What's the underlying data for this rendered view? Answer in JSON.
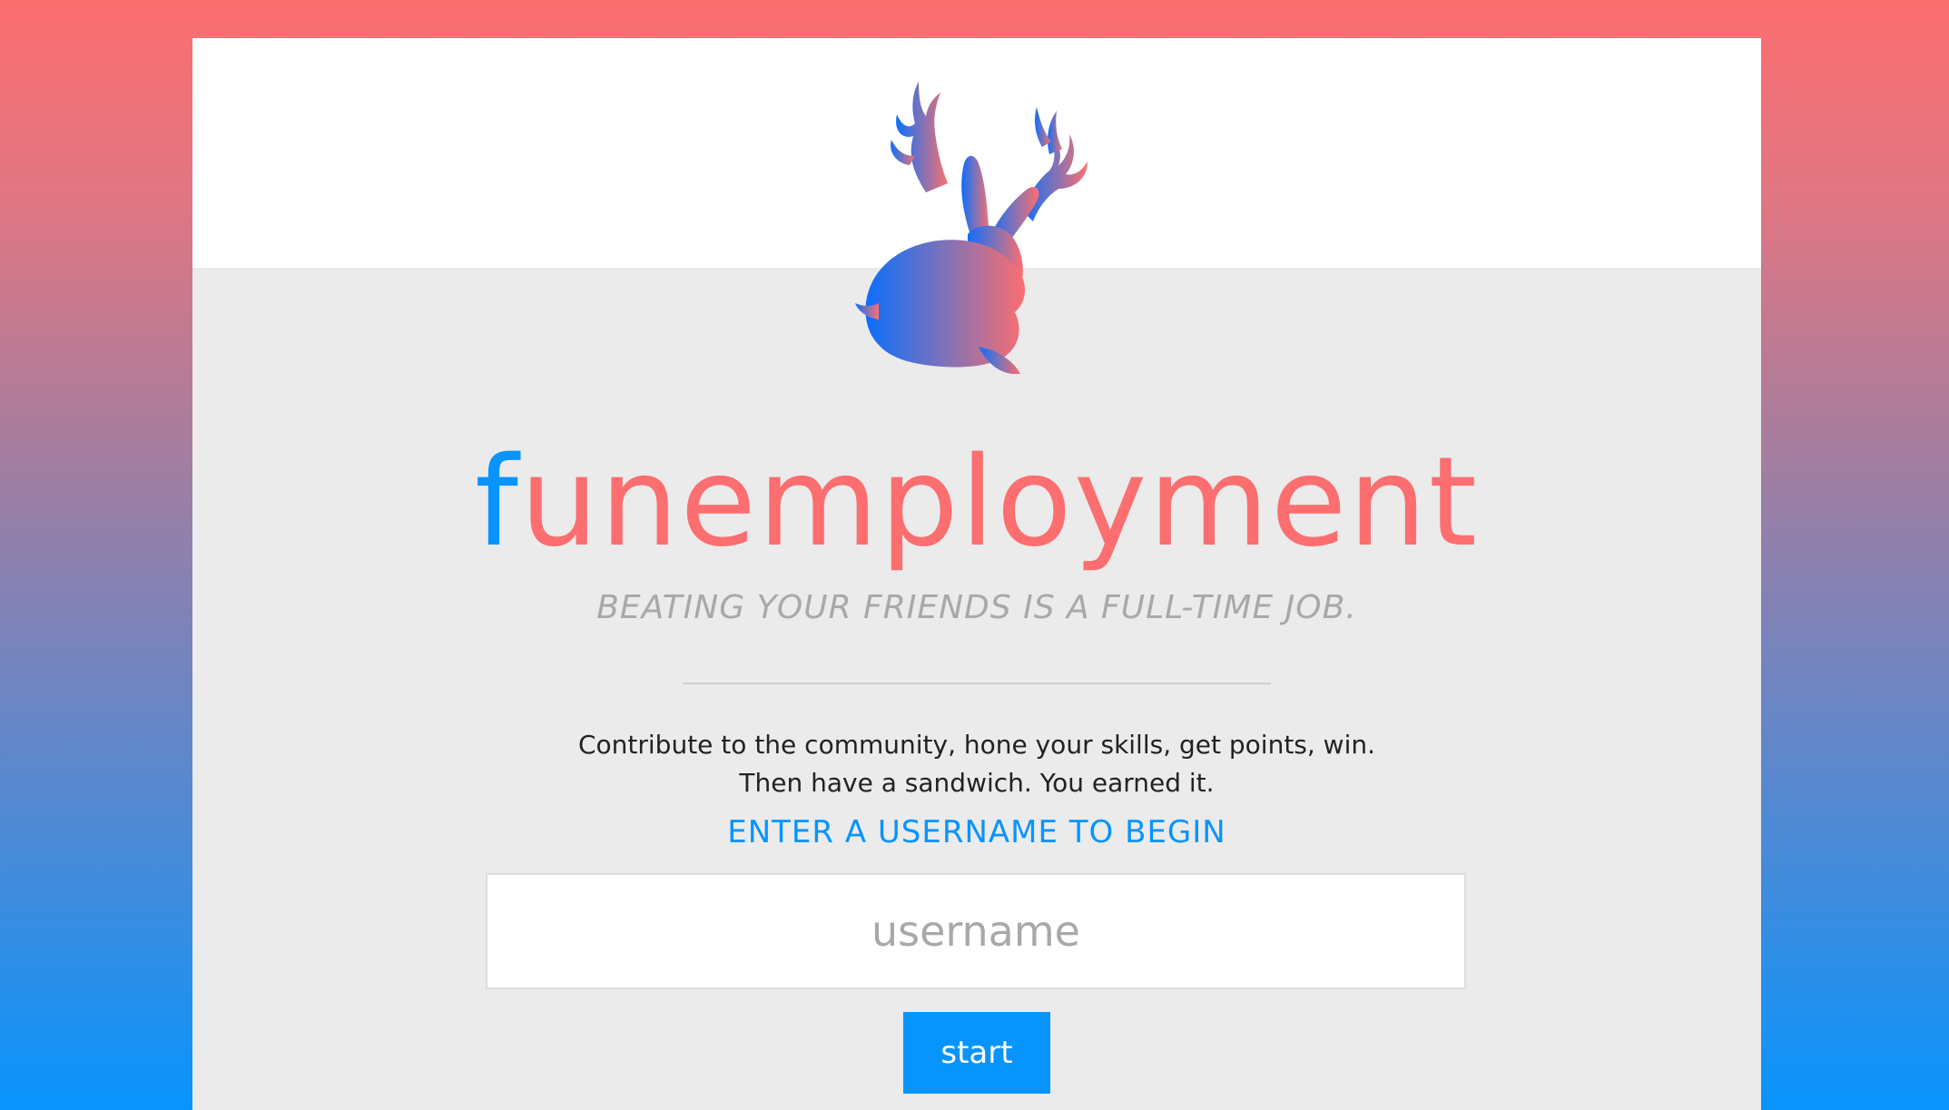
{
  "colors": {
    "accent_blue": "#0894fd",
    "accent_coral": "#fc6e6f",
    "panel_bg": "#ebebeb",
    "header_bg": "#ffffff"
  },
  "logo": {
    "icon": "jackalope-icon"
  },
  "brand": {
    "first_letter": "f",
    "rest": "unemployment"
  },
  "tagline": "BEATING YOUR FRIENDS IS A FULL-TIME JOB.",
  "description": {
    "line1": "Contribute to the community, hone your skills, get points, win.",
    "line2": "Then have a sandwich. You earned it."
  },
  "prompt": "ENTER A USERNAME TO BEGIN",
  "username_input": {
    "value": "",
    "placeholder": "username"
  },
  "start_button": {
    "label": "start"
  }
}
